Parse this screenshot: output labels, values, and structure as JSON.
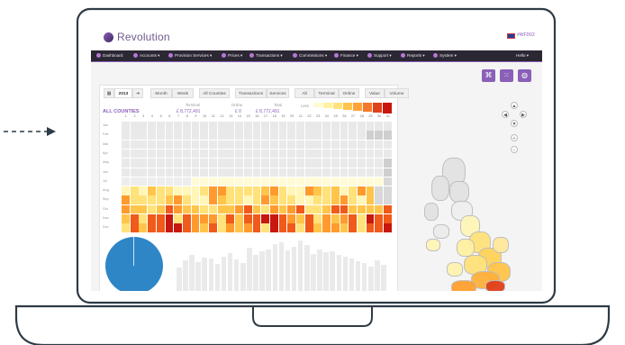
{
  "brand": {
    "name": "Revolution",
    "user_flag_text": "#WFD02"
  },
  "nav": {
    "items": [
      {
        "label": "Dashboard",
        "icon": "dashboard-icon"
      },
      {
        "label": "Accounts ▾",
        "icon": "accounts-icon"
      },
      {
        "label": "Provision Services ▾",
        "icon": "services-icon"
      },
      {
        "label": "Prices ▾",
        "icon": "prices-icon"
      },
      {
        "label": "Transactions ▾",
        "icon": "transactions-icon"
      },
      {
        "label": "Commissions ▾",
        "icon": "commissions-icon"
      },
      {
        "label": "Finance ▾",
        "icon": "finance-icon"
      },
      {
        "label": "Support ▾",
        "icon": "support-icon"
      },
      {
        "label": "Reports ▾",
        "icon": "reports-icon"
      },
      {
        "label": "System ▾",
        "icon": "system-icon"
      }
    ],
    "hello": "Hello ▾"
  },
  "toolbar": {
    "year": "2013",
    "period": [
      "Month",
      "Week"
    ],
    "scope": "All Counties",
    "mode": [
      "Transactions",
      "Services"
    ],
    "channel": [
      "All",
      "Terminal",
      "Online"
    ],
    "measure": [
      "Value",
      "Volume"
    ]
  },
  "summary": {
    "title": "ALL COUNTIES",
    "terminal_label": "Terminal",
    "terminal_value": "£ 8,772,491",
    "online_label": "Online",
    "online_value": "£ 0",
    "total_label": "Total",
    "total_value": "£ 8,772,491",
    "legend_low": "Less"
  },
  "heatmap": {
    "days": [
      "1",
      "2",
      "3",
      "4",
      "5",
      "6",
      "7",
      "8",
      "9",
      "10",
      "11",
      "12",
      "13",
      "14",
      "15",
      "16",
      "17",
      "18",
      "19",
      "20",
      "21",
      "22",
      "23",
      "24",
      "25",
      "26",
      "27",
      "28",
      "29",
      "30",
      "31"
    ],
    "months": [
      "Jan",
      "Feb",
      "Mar",
      "Apr",
      "May",
      "Jun",
      "Jul",
      "Aug",
      "Sep",
      "Oct",
      "Nov",
      "Dec"
    ]
  },
  "colors": {
    "accent": "#8a5fb8",
    "navbar": "#2b2733",
    "pie": "#2f86c6",
    "laptop": "#2f3b45"
  }
}
